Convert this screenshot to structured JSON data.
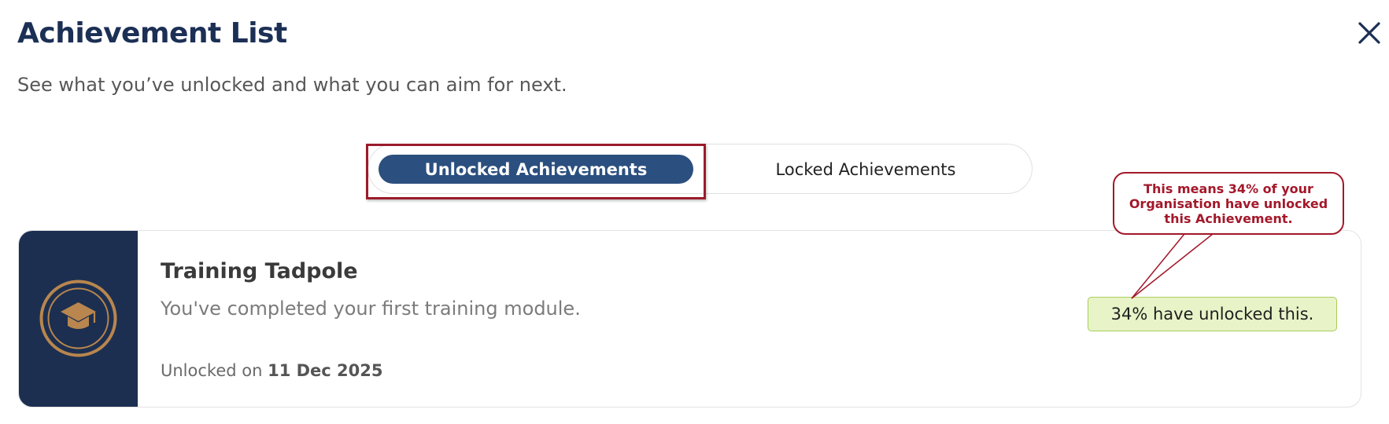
{
  "header": {
    "title": "Achievement List",
    "subtitle": "See what you’ve unlocked and what you can aim for next."
  },
  "tabs": [
    {
      "label": "Unlocked Achievements",
      "active": true
    },
    {
      "label": "Locked Achievements",
      "active": false
    }
  ],
  "achievement": {
    "title": "Training Tadpole",
    "description": "You've completed your first training module.",
    "unlocked_prefix": "Unlocked on",
    "unlocked_date": "11 Dec 2025",
    "percent_unlocked": 34,
    "stat_text": "34% have unlocked this.",
    "icon": "graduation-cap-icon"
  },
  "annotation": {
    "callout_text": "This means 34% of your Organisation have unlocked this Achievement."
  },
  "colors": {
    "navy": "#1c2f51",
    "tab_active": "#2b4f7e",
    "highlight": "#9b1b2b",
    "badge_gold": "#b8864e",
    "stat_bg": "#e8f4c8"
  }
}
